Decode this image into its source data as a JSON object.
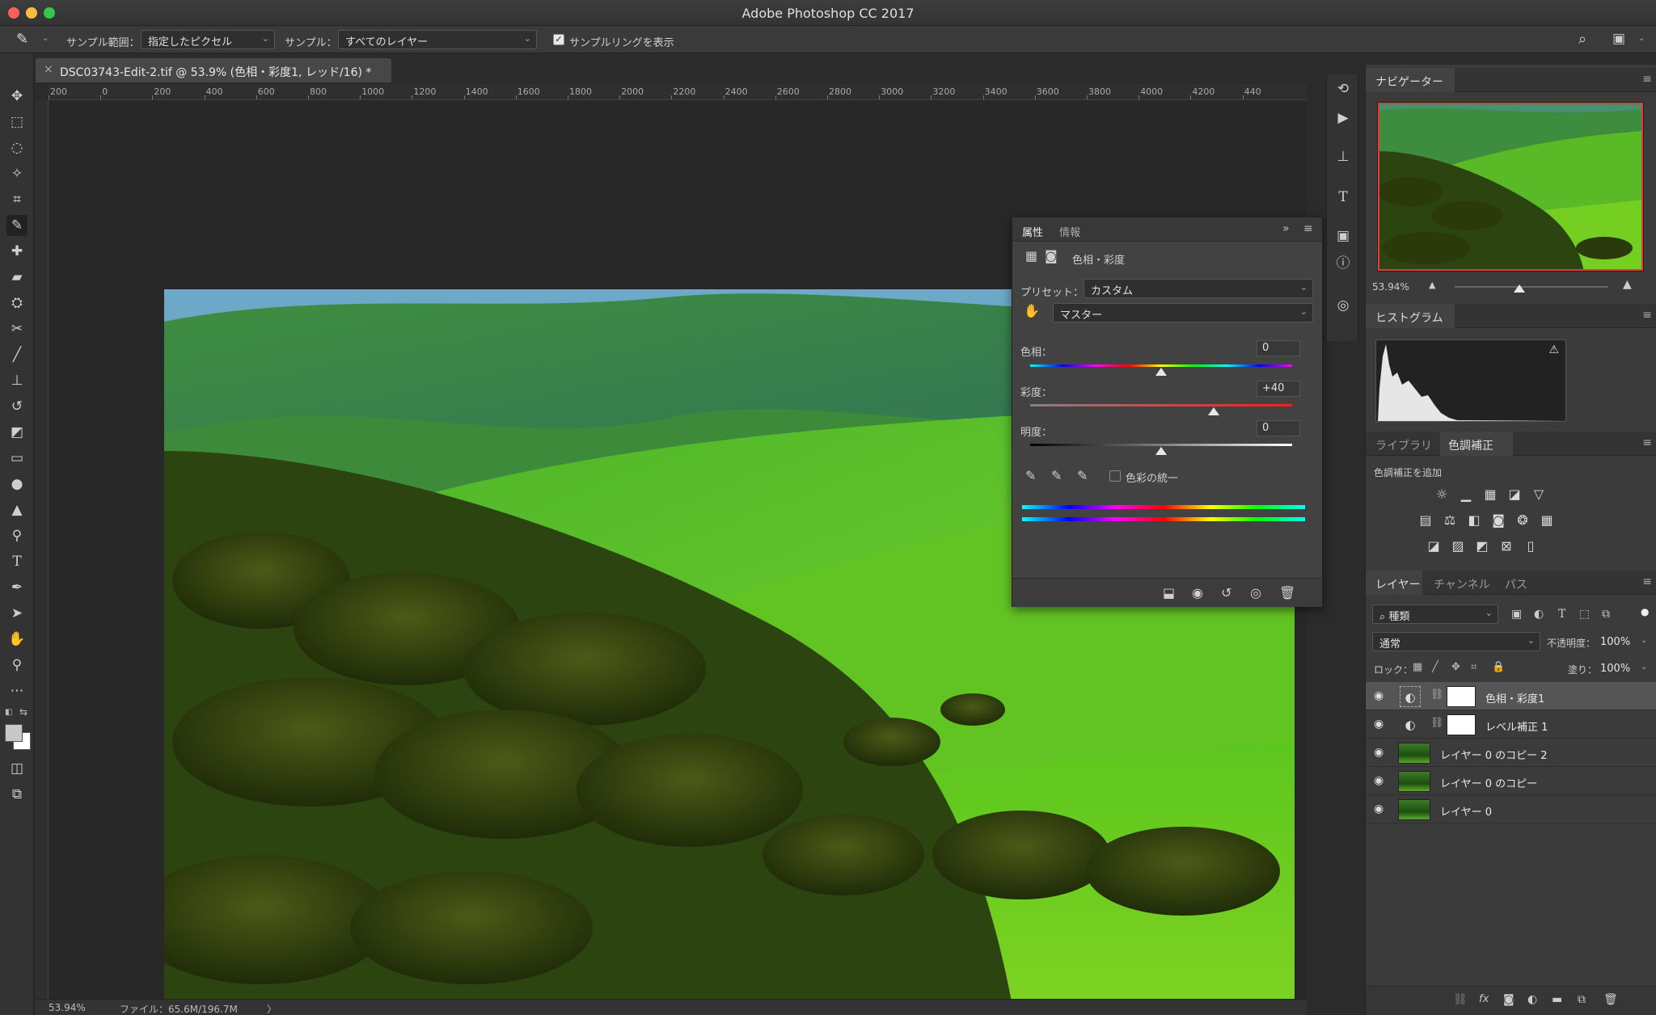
{
  "app": {
    "title": "Adobe Photoshop CC 2017"
  },
  "options_bar": {
    "sample_size_label": "サンプル範囲：",
    "sample_size_value": "指定したピクセル",
    "sample_label": "サンプル：",
    "sample_value": "すべてのレイヤー",
    "show_ring_label": "サンプルリングを表示",
    "show_ring_checked": true
  },
  "document": {
    "tab_title": "DSC03743-Edit-2.tif @ 53.9% (色相・彩度1, レッド/16) *",
    "ruler_labels": [
      "200",
      "0",
      "200",
      "400",
      "600",
      "800",
      "1000",
      "1200",
      "1400",
      "1600",
      "1800",
      "2000",
      "2200",
      "2400",
      "2600",
      "2800",
      "3000",
      "3200",
      "3400",
      "3600",
      "3800",
      "4000",
      "4200",
      "440"
    ]
  },
  "status": {
    "zoom": "53.94%",
    "file": "ファイル：65.6M/196.7M",
    "arrow": "〉"
  },
  "properties": {
    "tabs": [
      "属性",
      "情報"
    ],
    "title": "色相・彩度",
    "preset_label": "プリセット：",
    "preset_value": "カスタム",
    "channel_value": "マスター",
    "hue_label": "色相：",
    "hue_value": "0",
    "saturation_label": "彩度：",
    "saturation_value": "+40",
    "lightness_label": "明度：",
    "lightness_value": "0",
    "colorize_label": "色彩の統一",
    "colorize_checked": false,
    "sliders": {
      "hue_fraction": 0.5,
      "saturation_fraction": 0.7,
      "lightness_fraction": 0.5
    }
  },
  "navigator": {
    "title": "ナビゲーター",
    "zoom": "53.94%",
    "zoom_fraction": 0.42
  },
  "histogram": {
    "title": "ヒストグラム"
  },
  "adjustments": {
    "tabs": [
      "ライブラリ",
      "色調補正"
    ],
    "add_label": "色調補正を追加"
  },
  "layers": {
    "tabs": [
      "レイヤー",
      "チャンネル",
      "パス"
    ],
    "filter_value": "種類",
    "blend_mode": "通常",
    "opacity_label": "不透明度：",
    "opacity_value": "100%",
    "lock_label": "ロック：",
    "fill_label": "塗り：",
    "fill_value": "100%",
    "items": [
      {
        "name": "色相・彩度1",
        "type": "adjustment",
        "selected": true
      },
      {
        "name": "レベル補正 1",
        "type": "adjustment",
        "selected": false
      },
      {
        "name": "レイヤー 0 のコピー 2",
        "type": "pixel",
        "selected": false
      },
      {
        "name": "レイヤー 0 のコピー",
        "type": "pixel",
        "selected": false
      },
      {
        "name": "レイヤー 0",
        "type": "pixel",
        "selected": false
      }
    ]
  },
  "colors": {
    "accent_selected": "#555555",
    "nav_frame": "#e23b3b"
  }
}
